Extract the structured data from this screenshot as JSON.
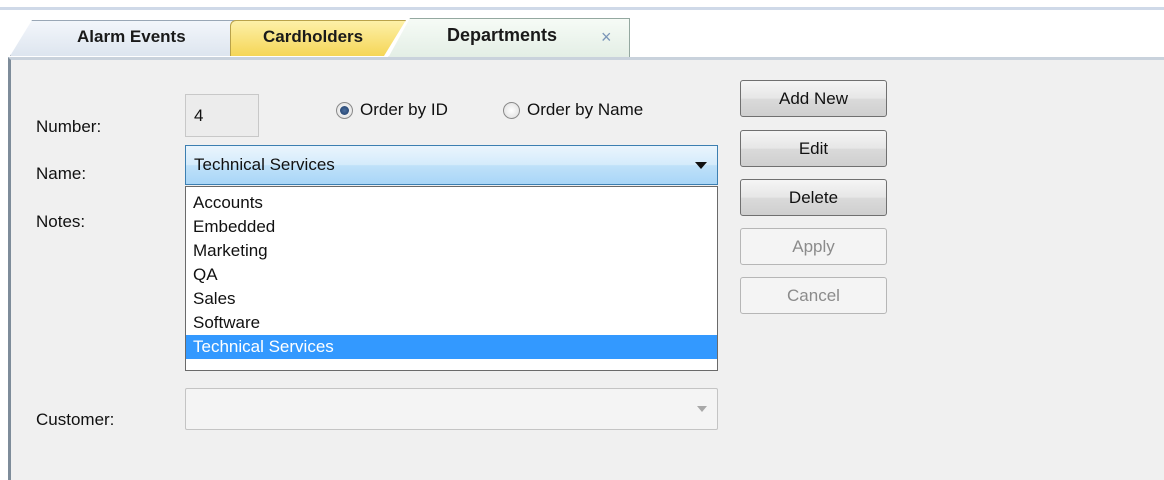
{
  "tabs": [
    {
      "label": "Alarm Events"
    },
    {
      "label": "Cardholders"
    },
    {
      "label": "Departments",
      "close": "×"
    }
  ],
  "form": {
    "number_label": "Number:",
    "number_value": "4",
    "name_label": "Name:",
    "name_value": "Technical Services",
    "notes_label": "Notes:",
    "customer_label": "Customer:",
    "customer_value": ""
  },
  "order": {
    "by_id": "Order by ID",
    "by_name": "Order by Name",
    "selected": "by_id"
  },
  "dropdown": {
    "options": [
      "Accounts",
      "Embedded",
      "Marketing",
      "QA",
      "Sales",
      "Software",
      "Technical Services"
    ],
    "selected_index": 6
  },
  "buttons": {
    "add_new": "Add New",
    "edit": "Edit",
    "delete": "Delete",
    "apply": "Apply",
    "cancel": "Cancel"
  },
  "colors": {
    "selection": "#3399ff",
    "cardholders_tab": "#f5d657"
  }
}
